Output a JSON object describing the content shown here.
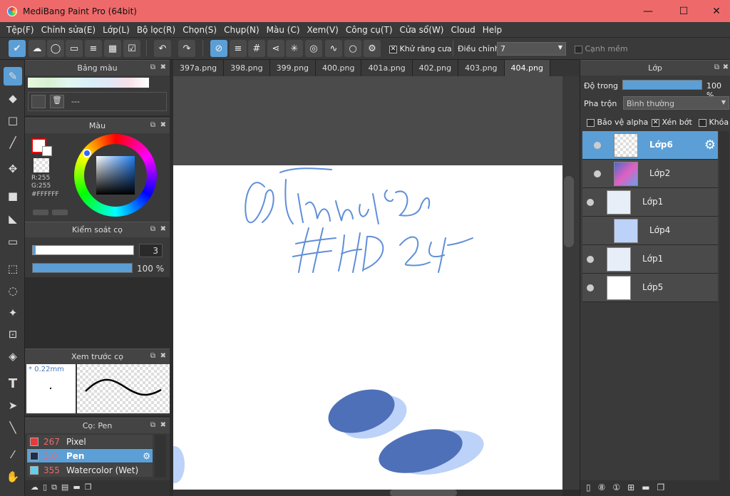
{
  "window": {
    "title": "MediBang Paint Pro (64bit)",
    "minimize": "—",
    "maximize": "☐",
    "close": "✕"
  },
  "menu": [
    "Tệp(F)",
    "Chỉnh sửa(E)",
    "Lớp(L)",
    "Bộ lọc(R)",
    "Chọn(S)",
    "Chụp(N)",
    "Màu (C)",
    "Xem(V)",
    "Công cụ(T)",
    "Cửa sổ(W)",
    "Cloud",
    "Help"
  ],
  "toolbar": {
    "antialias_label": "Khử răng cưa",
    "correction_label": "Điều chỉnh",
    "correction_value": "7",
    "soft_edge_label": "Cạnh mềm"
  },
  "palette_panel": {
    "title": "Bảng màu",
    "color_set_name": "---"
  },
  "color_panel": {
    "title": "Màu",
    "r": "R:255",
    "g": "G:255",
    "hex": "#FFFFFF",
    "primary_color": "#ff0000"
  },
  "brush_control": {
    "title": "Kiểm soát cọ",
    "size": "3",
    "opacity": "100 %",
    "opacity_fraction": 1
  },
  "brush_preview": {
    "title": "Xem trước cọ",
    "size_label": "* 0.22mm"
  },
  "brush_list": {
    "title": "Cọ: Pen",
    "items": [
      {
        "num": "267",
        "name": "Pixel",
        "color": "#e83a3a",
        "selected": false
      },
      {
        "num": "3.0",
        "name": "Pen",
        "color": "#1c2f4f",
        "selected": true
      },
      {
        "num": "355",
        "name": "Watercolor (Wet)",
        "color": "#5fd0f0",
        "selected": false
      }
    ]
  },
  "tabs": [
    {
      "label": "397a.png"
    },
    {
      "label": "398.png"
    },
    {
      "label": "399.png"
    },
    {
      "label": "400.png"
    },
    {
      "label": "401a.png"
    },
    {
      "label": "402.png"
    },
    {
      "label": "403.png"
    },
    {
      "label": "404.png",
      "active": true
    }
  ],
  "layers_panel": {
    "title": "Lớp",
    "opacity_label": "Độ trong",
    "opacity_value": "100 %",
    "blend_label": "Pha trộn",
    "blend_value": "Bình thường",
    "protect_alpha": "Bảo vệ alpha",
    "clipping": "Xén bớt",
    "lock": "Khóa"
  },
  "layers": [
    {
      "name": "Lớp6",
      "selected": true
    },
    {
      "name": "Lớp2"
    },
    {
      "name": "Lớp1"
    },
    {
      "name": "Lớp4"
    },
    {
      "name": "Lớp1"
    },
    {
      "name": "Lớp5"
    }
  ],
  "colors": {
    "accent": "#5b9fd6",
    "titlebar": "#ee6a6a"
  }
}
